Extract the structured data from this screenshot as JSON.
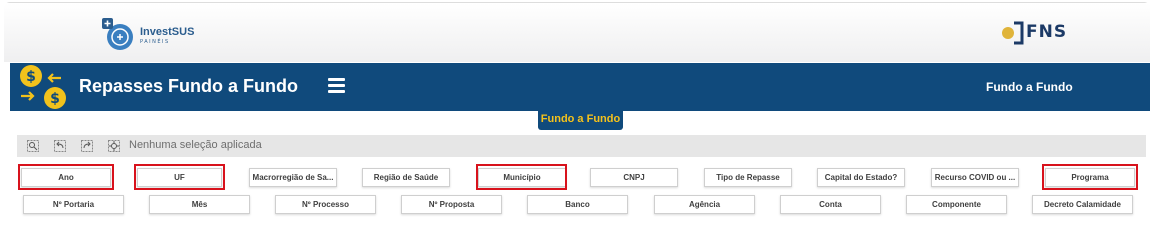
{
  "header": {
    "brand_name": "InvestSUS",
    "brand_sub": "PAINÉIS",
    "partner_logo": "FNS"
  },
  "navbar": {
    "title": "Repasses Fundo a Fundo",
    "right_label": "Fundo a Fundo"
  },
  "tab": {
    "label": "Fundo a Fundo"
  },
  "selections": {
    "status_text": "Nenhuma seleção aplicada"
  },
  "filters_row1": [
    "Ano",
    "UF",
    "Macrorregião de Sa...",
    "Região de Saúde",
    "Município",
    "CNPJ",
    "Tipo de Repasse",
    "Capital do Estado?",
    "Recurso COVID ou ...",
    "Programa"
  ],
  "filters_row2": [
    "Nº Portaria",
    "Mês",
    "Nº Processo",
    "Nº Proposta",
    "Banco",
    "Agência",
    "Conta",
    "Componente",
    "Decreto Calamidade"
  ],
  "highlighted_filters": [
    "Ano",
    "UF",
    "Município",
    "Programa"
  ],
  "colors": {
    "navbar": "#104a7c",
    "accent_yellow": "#f5c21b",
    "highlight": "#d8121c"
  }
}
